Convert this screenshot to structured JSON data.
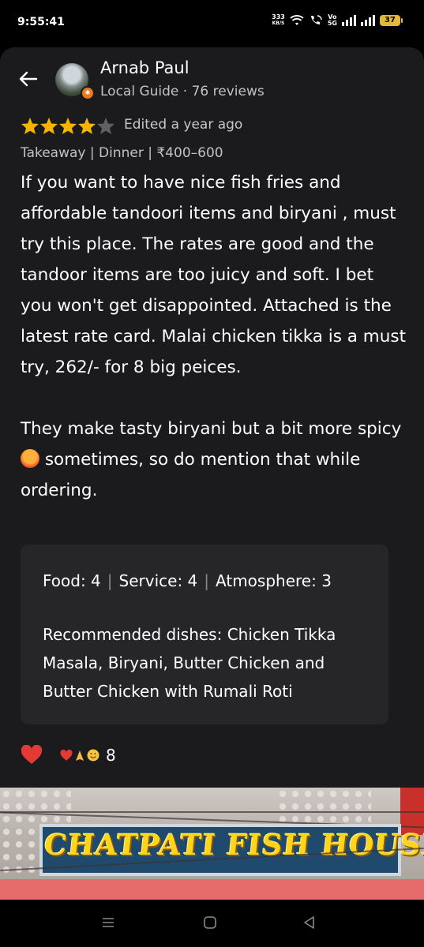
{
  "status_bar": {
    "time": "9:55:41",
    "net_speed_value": "333",
    "net_speed_unit": "KB/S",
    "volte_top": "Vo",
    "volte_bottom": "5G",
    "battery": "37"
  },
  "review": {
    "reviewer_name": "Arnab Paul",
    "reviewer_info": "Local Guide · 76 reviews",
    "rating": 4,
    "max_rating": 5,
    "edited": "Edited a year ago",
    "meta": "Takeaway | Dinner | ₹400–600",
    "text_part1": "If you want to have nice fish fries and affordable tandoori items and biryani , must try this place. The rates are good and the tandoor items are too juicy and soft. I bet you won't get disappointed. Attached is the latest rate card. Malai chicken tikka is a must try, 262/- for 8 big peices.\n\nThey make tasty biryani but a bit more spicy ",
    "text_part2": " sometimes, so do mention that while ordering.",
    "ratings": {
      "food": "Food: 4",
      "service": "Service: 4",
      "atmosphere": "Atmosphere: 3"
    },
    "recommended": "Recommended dishes: Chicken Tikka Masala, Biryani, Butter Chicken and Butter Chicken with Rumali Roti",
    "reaction_count": "8"
  },
  "photo": {
    "sign_text": "CHATPATI FISH HOUSE"
  },
  "colors": {
    "star_filled": "#f4b400",
    "star_empty": "#5f6063",
    "heart": "#e53935",
    "background": "#1b1b1d"
  }
}
